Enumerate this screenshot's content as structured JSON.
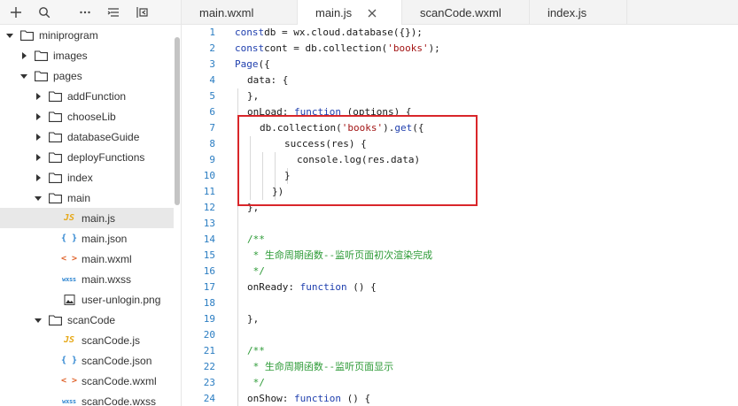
{
  "toolbar": {
    "icons": [
      "plus-icon",
      "search-icon",
      "more-icon",
      "collapse-icon",
      "split-icon"
    ]
  },
  "tree": [
    {
      "label": "miniprogram",
      "depth": 0,
      "type": "folder",
      "expanded": true
    },
    {
      "label": "images",
      "depth": 1,
      "type": "folder",
      "expanded": false
    },
    {
      "label": "pages",
      "depth": 1,
      "type": "folder",
      "expanded": true
    },
    {
      "label": "addFunction",
      "depth": 2,
      "type": "folder",
      "expanded": false
    },
    {
      "label": "chooseLib",
      "depth": 2,
      "type": "folder",
      "expanded": false
    },
    {
      "label": "databaseGuide",
      "depth": 2,
      "type": "folder",
      "expanded": false
    },
    {
      "label": "deployFunctions",
      "depth": 2,
      "type": "folder",
      "expanded": false
    },
    {
      "label": "index",
      "depth": 2,
      "type": "folder",
      "expanded": false
    },
    {
      "label": "main",
      "depth": 2,
      "type": "folder",
      "expanded": true
    },
    {
      "label": "main.js",
      "depth": 3,
      "type": "js",
      "selected": true
    },
    {
      "label": "main.json",
      "depth": 3,
      "type": "json"
    },
    {
      "label": "main.wxml",
      "depth": 3,
      "type": "wxml"
    },
    {
      "label": "main.wxss",
      "depth": 3,
      "type": "wxss"
    },
    {
      "label": "user-unlogin.png",
      "depth": 3,
      "type": "image"
    },
    {
      "label": "scanCode",
      "depth": 2,
      "type": "folder",
      "expanded": true
    },
    {
      "label": "scanCode.js",
      "depth": 3,
      "type": "js"
    },
    {
      "label": "scanCode.json",
      "depth": 3,
      "type": "json"
    },
    {
      "label": "scanCode.wxml",
      "depth": 3,
      "type": "wxml"
    },
    {
      "label": "scanCode.wxss",
      "depth": 3,
      "type": "wxss"
    }
  ],
  "icon_glyphs": {
    "js": "JS",
    "json": "{ }",
    "wxml": "< >",
    "wxss": "wxss"
  },
  "tabs": [
    {
      "label": "main.wxml",
      "active": false
    },
    {
      "label": "main.js",
      "active": true
    },
    {
      "label": "scanCode.wxml",
      "active": false
    },
    {
      "label": "index.js",
      "active": false
    }
  ],
  "code": [
    {
      "n": "1",
      "indent": 0,
      "tokens": [
        [
          "kw",
          "const"
        ],
        [
          "",
          "db = wx.cloud.database({});"
        ]
      ]
    },
    {
      "n": "2",
      "indent": 0,
      "tokens": [
        [
          "kw",
          "const"
        ],
        [
          "",
          "cont = db.collection("
        ],
        [
          "str",
          "'books'"
        ],
        [
          "",
          ");"
        ]
      ]
    },
    {
      "n": "3",
      "indent": 0,
      "tokens": [
        [
          "kw",
          "Page"
        ],
        [
          "",
          "({"
        ]
      ]
    },
    {
      "n": "4",
      "indent": 1,
      "tokens": [
        [
          "",
          "data: {"
        ]
      ]
    },
    {
      "n": "5",
      "indent": 1,
      "tokens": [
        [
          "",
          "},"
        ]
      ]
    },
    {
      "n": "6",
      "indent": 1,
      "tokens": [
        [
          "",
          "onLoad: "
        ],
        [
          "kw",
          "function"
        ],
        [
          "",
          " (options) {"
        ]
      ]
    },
    {
      "n": "7",
      "indent": 2,
      "tokens": [
        [
          "",
          "db.collection("
        ],
        [
          "str",
          "'books'"
        ],
        [
          "",
          ")."
        ],
        [
          "kw",
          "get"
        ],
        [
          "",
          "({"
        ]
      ]
    },
    {
      "n": "8",
      "indent": 4,
      "tokens": [
        [
          "",
          "success(res) {"
        ]
      ]
    },
    {
      "n": "9",
      "indent": 5,
      "tokens": [
        [
          "",
          "console.log(res.data)"
        ]
      ]
    },
    {
      "n": "10",
      "indent": 4,
      "tokens": [
        [
          "",
          "}"
        ]
      ]
    },
    {
      "n": "11",
      "indent": 3,
      "tokens": [
        [
          "",
          "})"
        ]
      ]
    },
    {
      "n": "12",
      "indent": 1,
      "tokens": [
        [
          "",
          "},"
        ]
      ]
    },
    {
      "n": "13",
      "indent": 0,
      "tokens": []
    },
    {
      "n": "14",
      "indent": 1,
      "tokens": [
        [
          "cmt",
          "/**"
        ]
      ]
    },
    {
      "n": "15",
      "indent": 1,
      "tokens": [
        [
          "cmt",
          " * 生命周期函数--监听页面初次渲染完成"
        ]
      ]
    },
    {
      "n": "16",
      "indent": 1,
      "tokens": [
        [
          "cmt",
          " */"
        ]
      ]
    },
    {
      "n": "17",
      "indent": 1,
      "tokens": [
        [
          "",
          "onReady: "
        ],
        [
          "kw",
          "function"
        ],
        [
          "",
          " () {"
        ]
      ]
    },
    {
      "n": "18",
      "indent": 0,
      "tokens": []
    },
    {
      "n": "19",
      "indent": 1,
      "tokens": [
        [
          "",
          "},"
        ]
      ]
    },
    {
      "n": "20",
      "indent": 0,
      "tokens": []
    },
    {
      "n": "21",
      "indent": 1,
      "tokens": [
        [
          "cmt",
          "/**"
        ]
      ]
    },
    {
      "n": "22",
      "indent": 1,
      "tokens": [
        [
          "cmt",
          " * 生命周期函数--监听页面显示"
        ]
      ]
    },
    {
      "n": "23",
      "indent": 1,
      "tokens": [
        [
          "cmt",
          " */"
        ]
      ]
    },
    {
      "n": "24",
      "indent": 1,
      "tokens": [
        [
          "",
          "onShow: "
        ],
        [
          "kw",
          "function"
        ],
        [
          "",
          " () {"
        ]
      ]
    }
  ],
  "colors": {
    "keyword": "#1f3fae",
    "string": "#a31515",
    "comment": "#2c9a36",
    "line_number": "#2b7dc2",
    "highlight_box": "#d9262a"
  }
}
